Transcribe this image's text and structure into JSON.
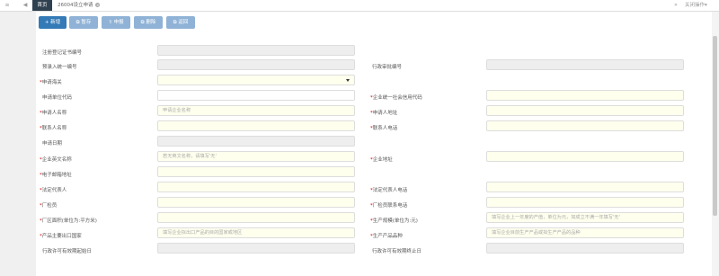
{
  "tabbar": {
    "home_label": "首页",
    "current_tab_label": "26004设立申请",
    "close_tab_glyph": "×",
    "close_ops_label": "关闭操作"
  },
  "toolbar": {
    "add": "新增",
    "save": "暂存",
    "submit": "申报",
    "delete": "删除",
    "back": "返回"
  },
  "form": {
    "reg_cert_no": "注册登记证书编号",
    "pre_entry_no": "预录入统一编号",
    "admin_approval_no": "行政审批编号",
    "customs": "申请海关",
    "applicant_code": "申请单位代码",
    "uscc": "企业统一社会信用代码",
    "applicant_name": "申请人名称",
    "applicant_name_placeholder": "申请企业名称",
    "applicant_address": "申请人地址",
    "contact_name": "联系人名称",
    "contact_phone": "联系人电话",
    "apply_date": "申请日期",
    "company_en_name": "企业英文名称",
    "company_en_name_placeholder": "若无英文名称，请填写'无'",
    "company_address": "企业地址",
    "email": "电子邮箱地址",
    "legal_rep": "法定代表人",
    "legal_rep_phone": "法定代表人电话",
    "factory_inspector": "厂检员",
    "inspector_phone": "厂检员联系电话",
    "factory_area": "厂区面积(单位为:平方米)",
    "capacity": "生产规模(单位为:元)",
    "capacity_placeholder": "填写企业上一年度的产值，单位为元，如成立不满一年填写'无'",
    "export_countries": "产品主要出口国家",
    "export_countries_placeholder": "填写企业拟出口产品的目的国家或地区",
    "product_category": "生产产品品种",
    "product_category_placeholder": "填写企业目前生产产品或拟生产产品的品种",
    "permit_start": "行政许可有效期起始日",
    "permit_end": "行政许可有效期终止日"
  },
  "colors": {
    "primary": "#337ab7",
    "button_disabled": "#8fb2d6",
    "required_mark": "#cc0000",
    "required_field_bg": "#ffffee",
    "readonly_field_bg": "#eeeeee",
    "home_tab_bg": "#2f4050"
  },
  "icons": [
    "collapse-left-icon",
    "close-tab-icon",
    "expand-right-icon",
    "plus-icon",
    "copy-icon",
    "upload-icon",
    "delete-icon",
    "return-icon",
    "dropdown-caret-icon"
  ]
}
